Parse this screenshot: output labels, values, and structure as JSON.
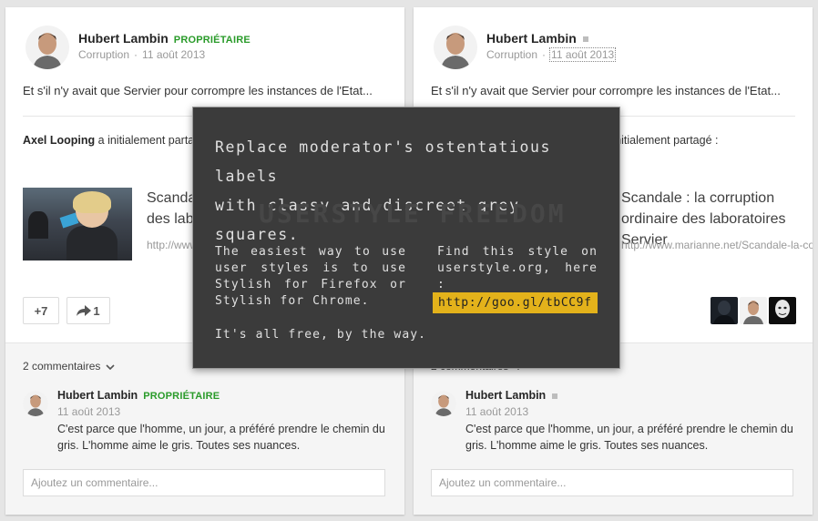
{
  "colors": {
    "owner_green": "#2a9b2a",
    "popup_bg": "#3b3b3b",
    "link_highlight": "#e3b21b",
    "moderator_square": "#bdbdbd"
  },
  "left_card": {
    "author": "Hubert Lambin",
    "owner_label": "PROPRIÉTAIRE",
    "category": "Corruption",
    "date": "11 août 2013",
    "post_text": "Et s'il n'y avait que Servier pour corrompre les instances de l'Etat...",
    "shared_by_name": "Axel Looping",
    "shared_by_rest": " a initialement partagé :",
    "link_title": "Scandale : la corruption ordinaire des laboratoires Servier",
    "link_url": "http://www.marianne.net/Scandale-la-corrupti...",
    "plus_count": "+7",
    "share_count": "1",
    "comments_count": "2 commentaires",
    "comment": {
      "author": "Hubert Lambin",
      "owner_label": "PROPRIÉTAIRE",
      "date": "11 août 2013",
      "text": "C'est parce que l'homme, un jour, a préféré prendre le chemin du gris. L'homme aime le gris. Toutes ses nuances."
    },
    "comment_placeholder": "Ajoutez un commentaire..."
  },
  "right_card": {
    "author": "Hubert Lambin",
    "category": "Corruption",
    "date": "11 août 2013",
    "post_text": "Et s'il n'y avait que Servier pour corrompre les instances de l'Etat...",
    "shared_by_rest": "a initialement partagé :",
    "link_title": "Scandale : la corruption ordinaire des laboratoires Servier",
    "link_url": "http://www.marianne.net/Scandale-la-corrupti...",
    "comments_count": "2 commentaires",
    "comment": {
      "author": "Hubert Lambin",
      "date": "11 août 2013",
      "text": "C'est parce que l'homme, un jour, a préféré prendre le chemin du gris. L'homme aime le gris. Toutes ses nuances."
    },
    "comment_placeholder": "Ajoutez un commentaire..."
  },
  "popup": {
    "heading": "Replace moderator's ostentatious labels\nwith classy and discreet grey squares.",
    "watermark": "USERSTYLE FREEDOM",
    "left_text": "The easiest way to use user styles is to use Stylish for Firefox or Stylish for Chrome.",
    "right_text": "Find this style on userstyle.org, here :",
    "link": "http://goo.gl/tbCC9f",
    "footer": "It's all free, by the way."
  }
}
